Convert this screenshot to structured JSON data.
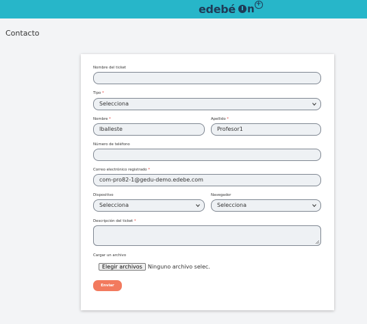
{
  "header": {
    "brand": "edebé",
    "brand_suffix": "On",
    "brand_color": "#1f3b57",
    "bar_color": "#27b6c9"
  },
  "page": {
    "title": "Contacto"
  },
  "form": {
    "ticket_name": {
      "label": "Nombre del ticket",
      "value": ""
    },
    "type": {
      "label": "Tipo",
      "required": "*",
      "value": "Selecciona"
    },
    "first_name": {
      "label": "Nombre",
      "required": "*",
      "value": "Iballeste"
    },
    "last_name": {
      "label": "Apellido",
      "required": "*",
      "value": "Profesor1"
    },
    "phone": {
      "label": "Número de teléfono",
      "value": ""
    },
    "email": {
      "label": "Correo electrónico registrado",
      "required": "*",
      "value": "com-pro82-1@gedu-demo.edebe.com"
    },
    "device": {
      "label": "Dispositivo",
      "value": "Selecciona"
    },
    "browser": {
      "label": "Navegador",
      "value": "Selecciona"
    },
    "description": {
      "label": "Descripción del ticket",
      "required": "*",
      "value": ""
    },
    "upload": {
      "label": "Cargar un archivo",
      "button": "Elegir archivos",
      "status": "Ninguno archivo selec."
    },
    "submit": {
      "label": "Enviar",
      "color": "#f27a5e"
    }
  }
}
